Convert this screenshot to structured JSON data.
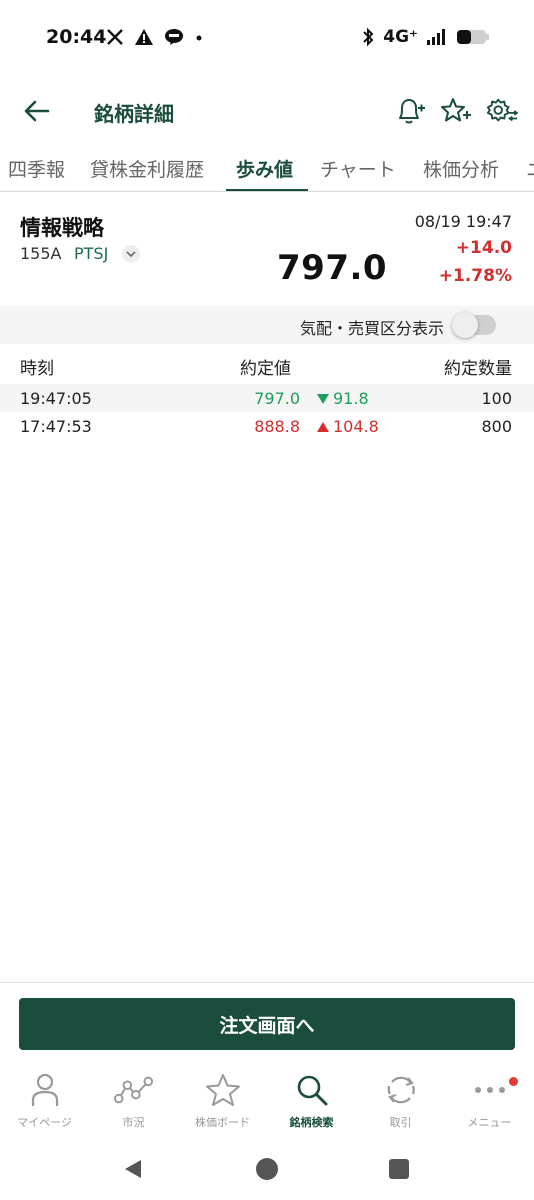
{
  "status_bar": {
    "time": "20:44",
    "network": "4G⁺",
    "icons_left": [
      "x-icon",
      "alert-icon",
      "line-icon",
      "dot-icon"
    ],
    "icons_right": [
      "bluetooth-icon",
      "network-4g-icon",
      "signal-icon",
      "battery-icon"
    ]
  },
  "header": {
    "title": "銘柄詳細",
    "icons": [
      "back-arrow-icon",
      "bell-add-icon",
      "star-add-icon",
      "settings-icon"
    ]
  },
  "tabs": [
    "四季報",
    "貸株金利履歴",
    "歩み値",
    "チャート",
    "株価分析",
    "ニ"
  ],
  "active_tab_index": 2,
  "stock": {
    "name": "情報戦略",
    "code": "155A",
    "market": "PTSJ",
    "price": "797.0",
    "datetime": "08/19 19:47",
    "change": "+14.0",
    "change_pct": "+1.78%"
  },
  "toggle": {
    "label": "気配・売買区分表示",
    "on": false
  },
  "table": {
    "headers": {
      "time": "時刻",
      "price": "約定値",
      "qty": "約定数量"
    },
    "rows": [
      {
        "time": "19:47:05",
        "price": "797.0",
        "diff": "91.8",
        "direction": "down",
        "qty": "100"
      },
      {
        "time": "17:47:53",
        "price": "888.8",
        "diff": "104.8",
        "direction": "up",
        "qty": "800"
      }
    ]
  },
  "order_button": {
    "label": "注文画面へ"
  },
  "bottom_nav": {
    "items": [
      {
        "label": "マイページ",
        "icon": "person-icon"
      },
      {
        "label": "市況",
        "icon": "market-chart-icon"
      },
      {
        "label": "株価ボード",
        "icon": "star-icon"
      },
      {
        "label": "銘柄検索",
        "icon": "search-icon"
      },
      {
        "label": "取引",
        "icon": "refresh-icon"
      },
      {
        "label": "メニュー",
        "icon": "more-icon"
      }
    ],
    "active_index": 3
  },
  "colors": {
    "brand": "#1b4d3e",
    "up": "#d32f2f",
    "down": "#1e9e5a"
  }
}
